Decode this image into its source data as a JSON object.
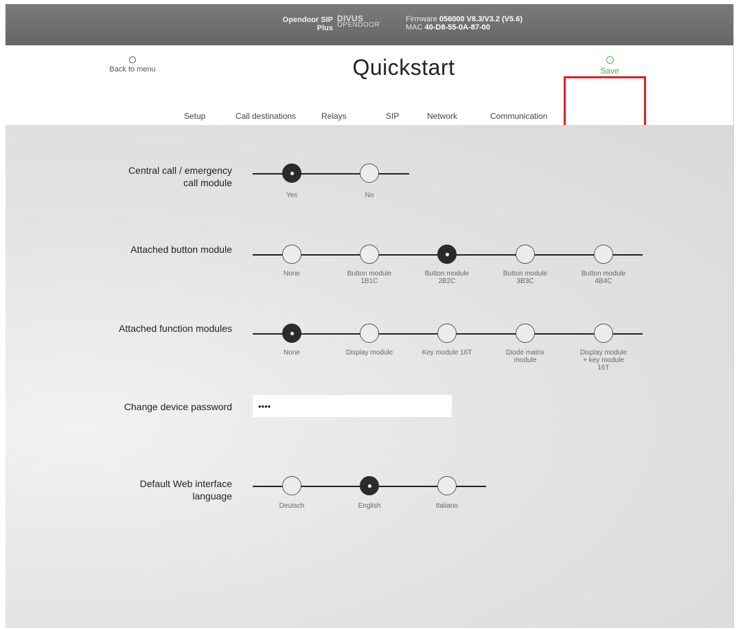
{
  "topbar": {
    "device_line1": "Opendoor SIP",
    "device_line2": "Plus",
    "logo_line1": "DIVUS",
    "logo_line2": "OPENDOOR",
    "firmware_prefix": "Firmware ",
    "firmware_value": "056000 V8.3/V3.2 (V5.6)",
    "mac_prefix": "MAC ",
    "mac_value": "40-D8-55-0A-87-00"
  },
  "header": {
    "back_label": "Back to menu",
    "title": "Quickstart",
    "save_label": "Save"
  },
  "tabs": [
    "Setup",
    "Call destinations",
    "Relays",
    "SIP",
    "Network",
    "Communication"
  ],
  "active_tab": "Setup",
  "settings": {
    "central_call": {
      "label_line1": "Central call / emergency",
      "label_line2": "call module",
      "options": [
        "Yes",
        "No"
      ],
      "selected": "Yes"
    },
    "button_module": {
      "label": "Attached button module",
      "options": [
        {
          "l1": "None",
          "l2": ""
        },
        {
          "l1": "Button module",
          "l2": "1B1C"
        },
        {
          "l1": "Button module",
          "l2": "2B2C"
        },
        {
          "l1": "Button module",
          "l2": "3B3C"
        },
        {
          "l1": "Button module",
          "l2": "4B4C"
        }
      ],
      "selected_index": 2
    },
    "function_modules": {
      "label": "Attached function modules",
      "options": [
        {
          "l1": "None",
          "l2": "",
          "l3": ""
        },
        {
          "l1": "Display module",
          "l2": "",
          "l3": ""
        },
        {
          "l1": "Key module 16T",
          "l2": "",
          "l3": ""
        },
        {
          "l1": "Diode matrix",
          "l2": "module",
          "l3": ""
        },
        {
          "l1": "Display module",
          "l2": "+ key module",
          "l3": "16T"
        }
      ],
      "selected_index": 0
    },
    "password": {
      "label": "Change device password",
      "value": "••••"
    },
    "language": {
      "label_line1": "Default Web interface",
      "label_line2": "language",
      "options": [
        "Deutsch",
        "English",
        "Italiano"
      ],
      "selected": "English"
    }
  }
}
